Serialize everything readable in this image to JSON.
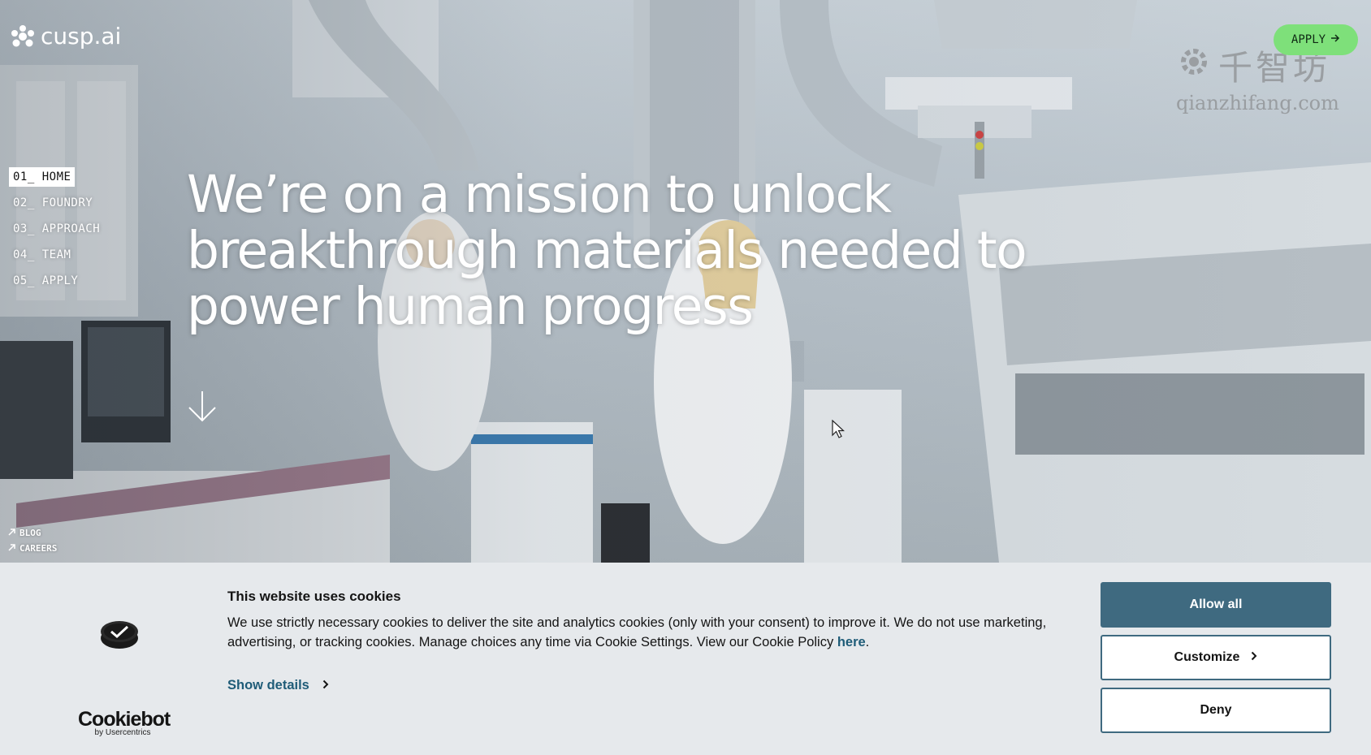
{
  "brand": {
    "logo_text": "cusp.ai"
  },
  "header": {
    "apply_label": "APPLY"
  },
  "watermark": {
    "cn": "千智坊",
    "en": "qianzhifang.com"
  },
  "nav": {
    "items": [
      {
        "label": "01_ HOME",
        "active": true
      },
      {
        "label": "02_ FOUNDRY",
        "active": false
      },
      {
        "label": "03_ APPROACH",
        "active": false
      },
      {
        "label": "04_ TEAM",
        "active": false
      },
      {
        "label": "05_ APPLY",
        "active": false
      }
    ]
  },
  "hero": {
    "headline_line1": "We’re on a mission to unlock",
    "headline_line2": "breakthrough materials needed to",
    "headline_line3": "power human progress"
  },
  "footer_links": {
    "blog": "BLOG",
    "careers": "CAREERS"
  },
  "cookie_banner": {
    "title": "This website uses cookies",
    "body": "We use strictly necessary cookies to deliver the site and analytics cookies (only with your consent) to improve it. We do not use marketing, advertising, or tracking cookies. Manage choices any time via Cookie Settings. View our Cookie Policy ",
    "policy_link": "here",
    "body_end": ".",
    "show_details": "Show details",
    "allow_all": "Allow all",
    "customize": "Customize",
    "deny": "Deny",
    "brand_name": "Cookiebot",
    "brand_by": "by Usercentrics"
  },
  "colors": {
    "apply_green": "#7ee07a",
    "cookie_accent": "#3f6a80",
    "link_blue": "#1f5c78"
  },
  "icons": [
    "cusp-logo-icon",
    "arrow-right-icon",
    "arrow-down-icon",
    "arrow-up-right-icon",
    "cursor-icon",
    "cookiebot-icon",
    "chevron-right-icon"
  ]
}
